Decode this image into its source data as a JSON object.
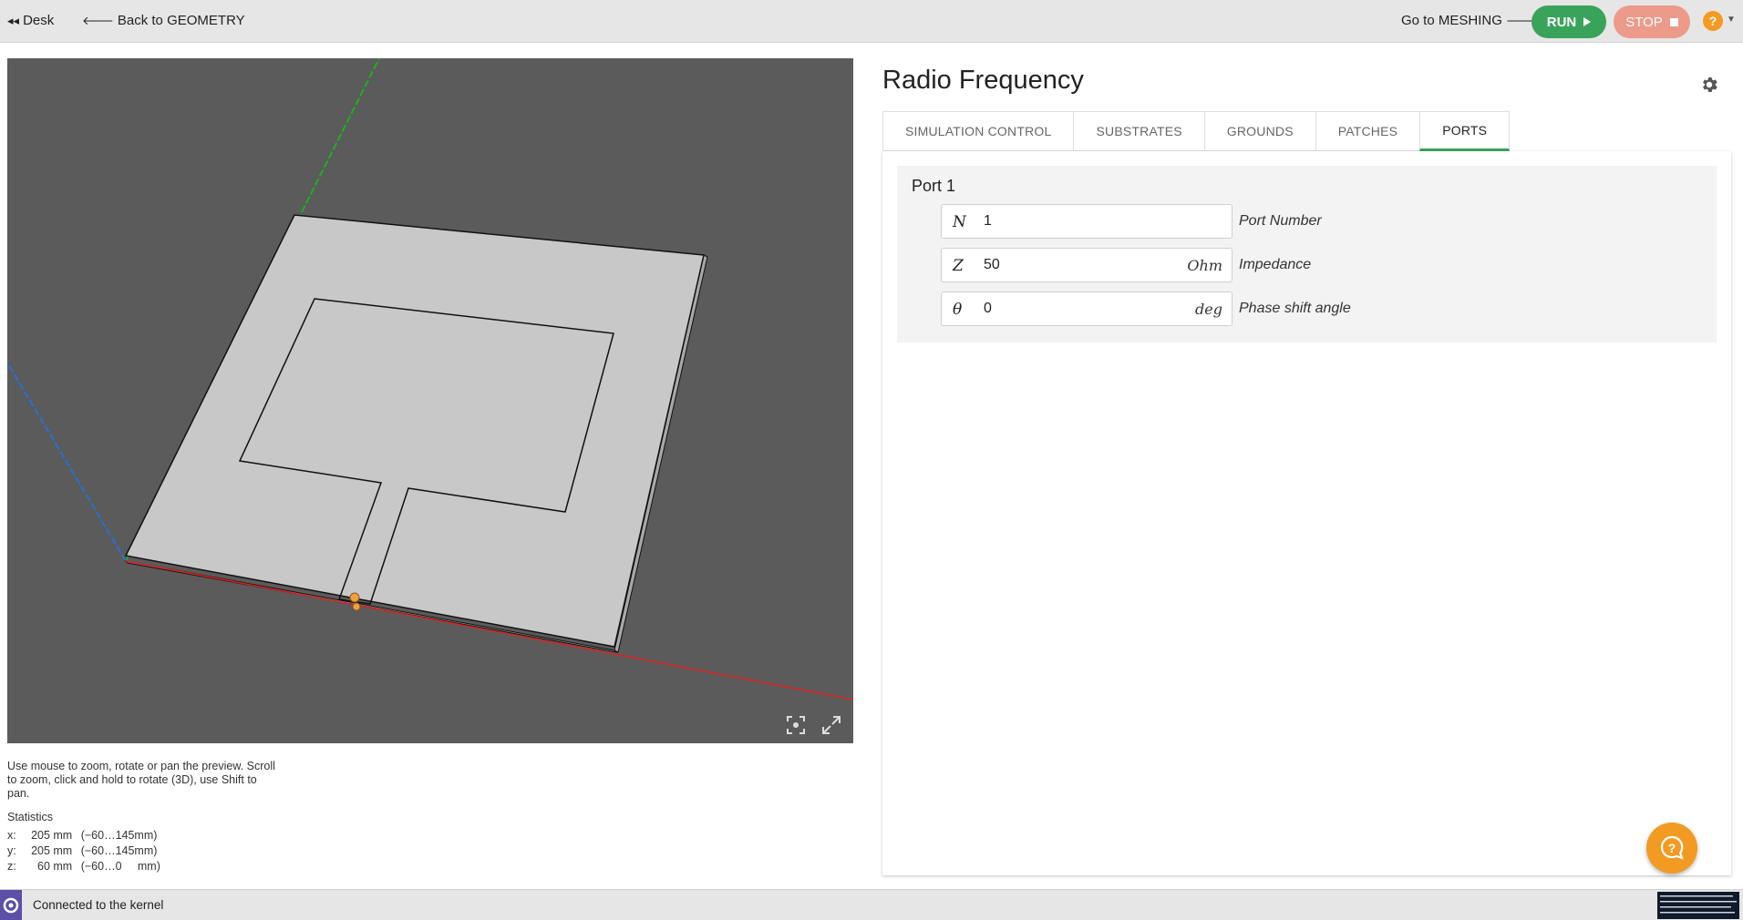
{
  "topbar": {
    "desk_label": "Desk",
    "back_label": "Back to GEOMETRY",
    "meshing_label": "Go to MESHING",
    "run_label": "RUN",
    "stop_label": "STOP",
    "help_label": "?"
  },
  "viewport": {
    "hint": "Use mouse to zoom, rotate or pan the preview. Scroll to zoom, click and hold to rotate (3D), use Shift to pan.",
    "stats_title": "Statistics",
    "stats": [
      {
        "axis": "x:",
        "size": "205 mm",
        "range": "(−60…145mm)"
      },
      {
        "axis": "y:",
        "size": "205 mm",
        "range": "(−60…145mm)"
      },
      {
        "axis": "z:",
        "size": "60 mm",
        "range": "(−60…0     mm)"
      }
    ],
    "colors": {
      "background": "#5b5b5b",
      "x_axis": "#e02020",
      "y_axis": "#20b020",
      "z_axis": "#2a6fd6",
      "solid": "#c8c8c8"
    }
  },
  "panel": {
    "title": "Radio Frequency",
    "tabs": [
      {
        "label": "SIMULATION CONTROL",
        "active": false
      },
      {
        "label": "SUBSTRATES",
        "active": false
      },
      {
        "label": "GROUNDS",
        "active": false
      },
      {
        "label": "PATCHES",
        "active": false
      },
      {
        "label": "PORTS",
        "active": true
      }
    ],
    "port": {
      "title": "Port 1",
      "fields": [
        {
          "symbol": "N",
          "value": "1",
          "unit": "",
          "label": "Port Number"
        },
        {
          "symbol": "Z",
          "value": "50",
          "unit": "Ohm",
          "label": "Impedance"
        },
        {
          "symbol": "θ",
          "value": "0",
          "unit": "deg",
          "label": "Phase shift angle"
        }
      ]
    }
  },
  "status": {
    "text": "Connected to the kernel"
  },
  "accent_colors": {
    "run": "#3aa35b",
    "stop": "#ec9a8a",
    "help": "#f29a21",
    "tab_active": "#3aa35b"
  }
}
